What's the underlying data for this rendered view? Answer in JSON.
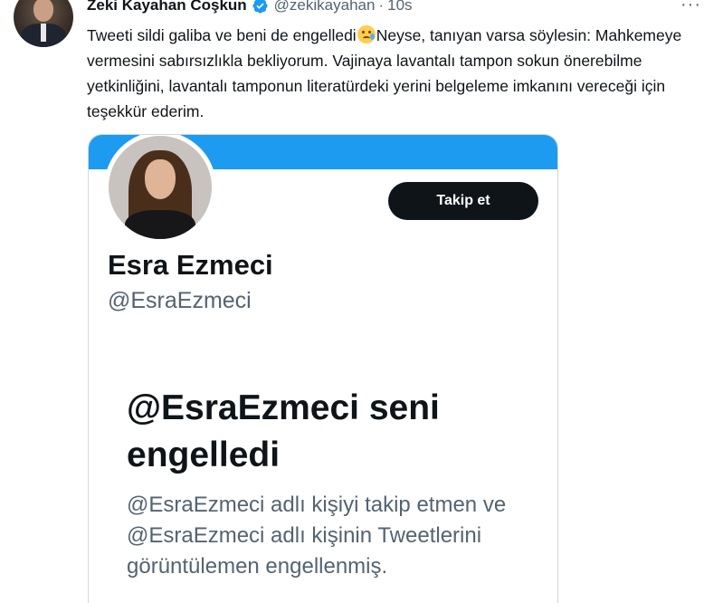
{
  "tweet": {
    "author": {
      "display_name": "Zeki Kayahan Coşkun",
      "handle": "@zekikayahan",
      "verified": true
    },
    "separator": "·",
    "time": "10s",
    "more_label": "···",
    "text_before_emoji": "Tweeti sildi galiba ve beni de engelledi",
    "emoji": "face-holding-back-tears",
    "text_after_emoji": "Neyse, tanıyan varsa söylesin: Mahkemeye vermesini sabırsızlıkla bekliyorum. Vajinaya lavantalı tampon sokun önerebilme yetkinliğini, lavantalı tamponun literatürdeki yerini belgeleme imkanını vereceği için teşekkür ederim."
  },
  "media": {
    "banner_color": "#1d9bf0",
    "follow_button_label": "Takip et",
    "profile_name": "Esra Ezmeci",
    "profile_handle": "@EsraEzmeci",
    "blocked_title": "@EsraEzmeci seni engelledi",
    "blocked_description": "@EsraEzmeci adlı kişiyi takip etmen ve @EsraEzmeci adlı kişinin Tweetlerini görüntülemen engellenmiş."
  }
}
